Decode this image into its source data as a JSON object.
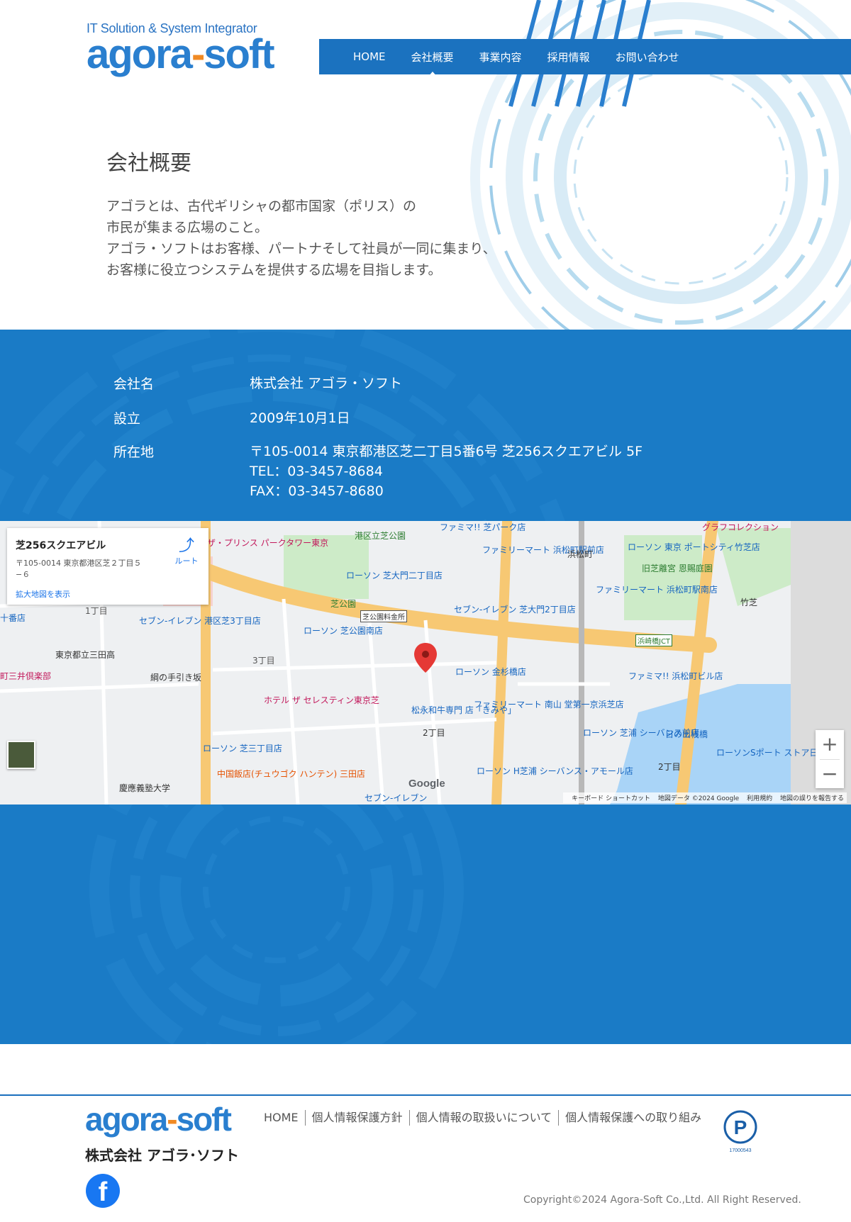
{
  "header": {
    "logo_tagline": "IT Solution & System Integrator",
    "logo_part1": "agora",
    "logo_dash": "-",
    "logo_part2": "soft",
    "nav": [
      {
        "label": "HOME"
      },
      {
        "label": "会社概要",
        "active": true
      },
      {
        "label": "事業内容"
      },
      {
        "label": "採用情報"
      },
      {
        "label": "お問い合わせ"
      }
    ]
  },
  "intro": {
    "title": "会社概要",
    "lines": [
      "アゴラとは、古代ギリシャの都市国家（ポリス）の",
      "市民が集まる広場のこと。",
      "アゴラ・ソフトはお客様、パートナそして社員が一同に集まり、",
      "お客様に役立つシステムを提供する広場を目指します。"
    ]
  },
  "company_info": {
    "rows": [
      {
        "label": "会社名",
        "values": [
          "株式会社 アゴラ・ソフト"
        ]
      },
      {
        "label": "設立",
        "values": [
          "2009年10月1日"
        ]
      },
      {
        "label": "所在地",
        "values": [
          "〒105-0014 東京都港区芝二丁目5番6号 芝256スクエアビル 5F",
          "TEL：03-3457-8684",
          "FAX：03-3457-8680"
        ]
      }
    ]
  },
  "map": {
    "card_title": "芝256スクエアビル",
    "card_address": "〒105-0014 東京都港区芝２丁目５−６",
    "card_link": "拡大地図を表示",
    "route_label": "ルート",
    "zoom_in": "+",
    "zoom_out": "−",
    "google": "Google",
    "attribution": [
      "キーボード ショートカット",
      "地図データ ©2024 Google",
      "利用規約",
      "地図の誤りを報告する"
    ],
    "labels": [
      "港区立芝公園",
      "ザ・プリンス パークタワー東京",
      "ファミマ!! 芝パーク店",
      "グラフコレクション",
      "ファミリーマート 浜松町駅前店",
      "浜松町",
      "ローソン 東京 ポートシティ竹芝店",
      "旧芝離宮 恩賜庭園",
      "ローソン 芝大門二丁目店",
      "芝公園",
      "芝公園料金所",
      "セブン-イレブン 芝大門2丁目店",
      "ファミリーマート 浜松町駅南店",
      "竹芝",
      "1丁目",
      "十番店",
      "セブン-イレブン 港区芝3丁目店",
      "ローソン 芝公園南店",
      "浜崎橋JCT",
      "東京都立三田高",
      "3丁目",
      "ローソン 金杉橋店",
      "ファミマ!! 浜松町ビル店",
      "町三井倶楽部",
      "綱の手引き坂",
      "ホテル ザ セレスティン東京芝",
      "松永和牛専門 店「きみや」",
      "ファミリーマート 南山 堂第一京浜芝店",
      "2丁目",
      "ローソン 芝浦 シーバンス前店",
      "日の出桟橋",
      "ローソン 芝三丁目店",
      "ローソン H芝浦 シーバンス・アモール店",
      "ローソンSポート ストア日の出店",
      "中国飯店(チュウゴク ハンテン) 三田店",
      "慶應義塾大学",
      "セブン-イレブン",
      "2丁目"
    ]
  },
  "footer": {
    "logo_part1": "agora",
    "logo_dash": "-",
    "logo_part2": "soft",
    "company": "株式会社 アゴラ･ソフト",
    "links": [
      "HOME",
      "個人情報保護方針",
      "個人情報の取扱いについて",
      "個人情報保護への取り組み"
    ],
    "privacy_mark_number": "17000543",
    "privacy_mark_text": "たいせつにしますプライバシー",
    "facebook": "f",
    "copyright": "Copyright©2024 Agora-Soft Co.,Ltd. All Right Reserved."
  },
  "colors": {
    "brand_blue": "#1a7bc6",
    "nav_blue": "#1b72bf",
    "logo_orange": "#f08a24"
  }
}
